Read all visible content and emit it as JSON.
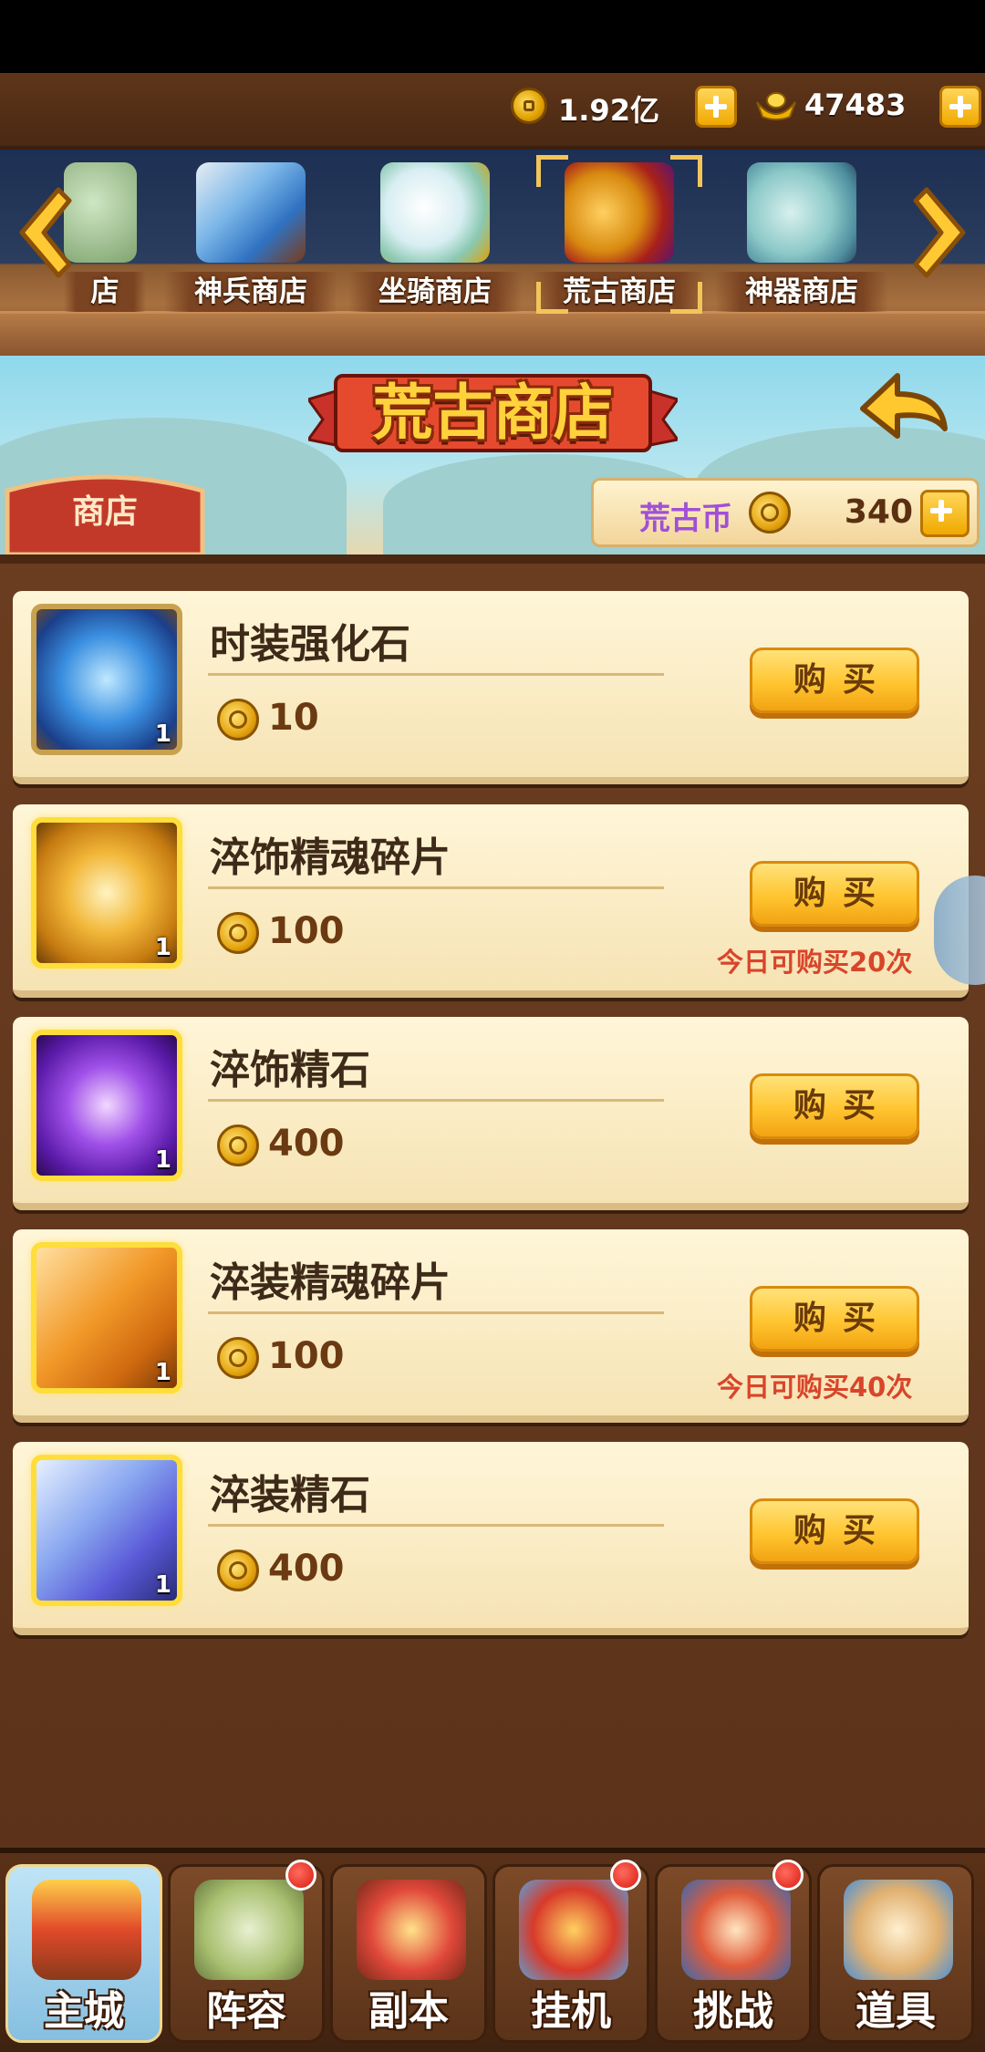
{
  "currency": {
    "coins": "1.92亿",
    "gold_ingots": "47483"
  },
  "shop_tabs": [
    {
      "label": "店",
      "icon": "partial-shop-icon"
    },
    {
      "label": "神兵商店",
      "icon": "sword-shield-icon"
    },
    {
      "label": "坐骑商店",
      "icon": "deer-mount-icon"
    },
    {
      "label": "荒古商店",
      "icon": "ancient-gem-icon",
      "selected": true
    },
    {
      "label": "神器商店",
      "icon": "artifact-token-icon"
    }
  ],
  "banner": {
    "title": "荒古商店",
    "side_tab": "商店",
    "ancient_coin_label": "荒古币",
    "ancient_coin_value": "340"
  },
  "items": [
    {
      "name": "时装强化石",
      "price": "10",
      "qty": "1",
      "button": "购买",
      "limit": "",
      "icon": "blue-crystal-icon"
    },
    {
      "name": "淬饰精魂碎片",
      "price": "100",
      "qty": "1",
      "button": "购买",
      "limit": "今日可购买20次",
      "icon": "golden-orb-icon"
    },
    {
      "name": "淬饰精石",
      "price": "400",
      "qty": "1",
      "button": "购买",
      "limit": "",
      "icon": "purple-orb-icon"
    },
    {
      "name": "淬装精魂碎片",
      "price": "100",
      "qty": "1",
      "button": "购买",
      "limit": "今日可购买40次",
      "icon": "orange-sword-stone-icon"
    },
    {
      "name": "淬装精石",
      "price": "400",
      "qty": "1",
      "button": "购买",
      "limit": "",
      "icon": "blue-sword-stone-icon"
    }
  ],
  "bottom_nav": [
    {
      "label": "主城",
      "active": true,
      "badge": false
    },
    {
      "label": "阵容",
      "active": false,
      "badge": true
    },
    {
      "label": "副本",
      "active": false,
      "badge": false
    },
    {
      "label": "挂机",
      "active": false,
      "badge": true
    },
    {
      "label": "挑战",
      "active": false,
      "badge": true
    },
    {
      "label": "道具",
      "active": false,
      "badge": false
    }
  ],
  "colors": {
    "background": "#6b3f22",
    "card": "#fff6d8",
    "buy_button": "#ffc530",
    "limit_text": "#d8452a",
    "ancient_label": "#a050d8"
  }
}
